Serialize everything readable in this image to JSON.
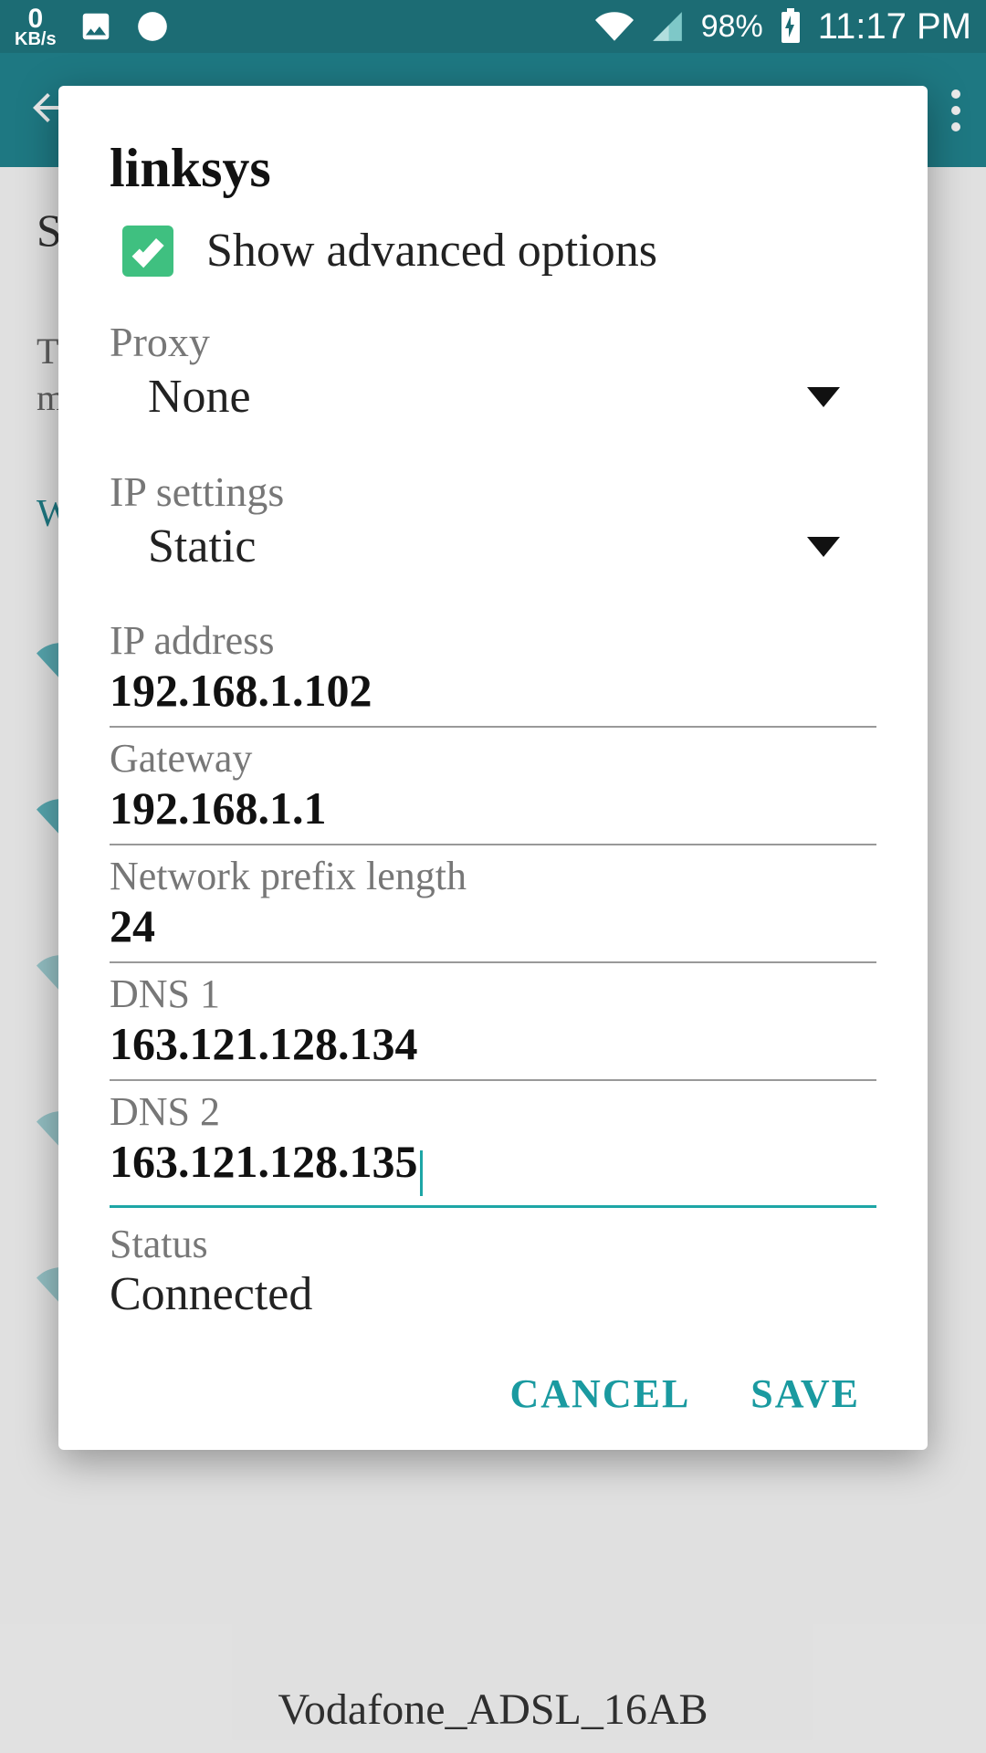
{
  "statusbar": {
    "kbs_num": "0",
    "kbs_unit": "KB/s",
    "battery_pct": "98%",
    "time": "11:17 PM"
  },
  "bg": {
    "row1_head": "S",
    "row1_sub1": "Th",
    "row1_sub2": "mo",
    "wifi_label": "Wi",
    "bottom_ssid": "Vodafone_ADSL_16AB"
  },
  "dialog": {
    "title": "linksys",
    "show_advanced_label": "Show advanced options",
    "proxy_label": "Proxy",
    "proxy_value": "None",
    "ipsettings_label": "IP settings",
    "ipsettings_value": "Static",
    "ip_label": "IP address",
    "ip_value": "192.168.1.102",
    "gateway_label": "Gateway",
    "gateway_value": "192.168.1.1",
    "prefix_label": "Network prefix length",
    "prefix_value": "24",
    "dns1_label": "DNS 1",
    "dns1_value": "163.121.128.134",
    "dns2_label": "DNS 2",
    "dns2_value": "163.121.128.135",
    "status_label": "Status",
    "status_value": "Connected",
    "cancel": "CANCEL",
    "save": "SAVE"
  }
}
